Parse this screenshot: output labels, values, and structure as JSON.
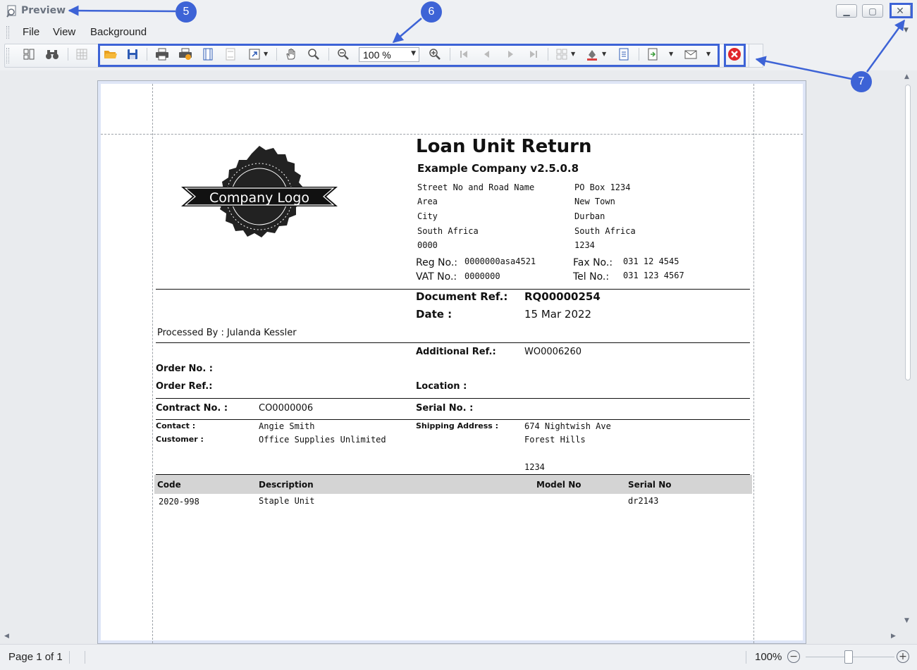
{
  "window": {
    "title": "Preview",
    "controls": {
      "minimize": "▁",
      "maximize": "▢",
      "close": "✕"
    }
  },
  "menu": {
    "items": [
      "File",
      "View",
      "Background"
    ]
  },
  "toolbar": {
    "zoom_value": "100 %",
    "icons": [
      "panes-icon",
      "find-icon",
      "thumbnails-icon",
      "open-icon",
      "save-icon",
      "print-icon",
      "quick-print-icon",
      "page-setup-icon",
      "header-footer-icon",
      "scale-icon",
      "hand-tool-icon",
      "magnifier-icon",
      "zoom-out-icon",
      "zoom-in-icon",
      "first-page-icon",
      "previous-page-icon",
      "next-page-icon",
      "last-page-icon",
      "multiple-pages-icon",
      "background-color-icon",
      "watermark-icon",
      "export-icon",
      "email-icon",
      "close-preview-icon"
    ]
  },
  "callouts": {
    "c5": "5",
    "c6": "6",
    "c7": "7"
  },
  "colors": {
    "annotation": "#3d63d6",
    "close_preview": "#e0262b",
    "table_header": "#d4d4d4"
  },
  "document": {
    "title": "Loan Unit Return",
    "company_name": "Example Company v2.5.0.8",
    "logo_text": "Company Logo",
    "address_left": [
      "Street No and Road Name",
      "Area",
      "City",
      "South Africa",
      "0000"
    ],
    "address_right": [
      "PO Box 1234",
      "New Town",
      "Durban",
      "South Africa",
      "1234"
    ],
    "reg_label": "Reg No.:",
    "reg_value": "0000000asa4521",
    "vat_label": "VAT No.:",
    "vat_value": "0000000",
    "fax_label": "Fax No.:",
    "fax_value": "031 12 4545",
    "tel_label": "Tel No.:",
    "tel_value": "031 123 4567",
    "docref_label": "Document Ref.:",
    "docref_value": "RQ00000254",
    "date_label": "Date :",
    "date_value": "15 Mar 2022",
    "processed_by": "Processed By : Julanda Kessler",
    "addref_label": "Additional Ref.:",
    "addref_value": "WO0006260",
    "order_no_label": "Order No. :",
    "order_ref_label": "Order Ref.:",
    "location_label": "Location :",
    "contract_label": "Contract No. :",
    "contract_value": "CO0000006",
    "serial_label": "Serial No. :",
    "contact_label": "Contact :",
    "contact_value": "Angie Smith",
    "customer_label": "Customer :",
    "customer_value": "Office Supplies Unlimited",
    "shipping_label": "Shipping Address :",
    "shipping_lines": [
      "674 Nightwish Ave",
      "Forest Hills",
      "",
      "1234"
    ],
    "table": {
      "headers": [
        "Code",
        "Description",
        "Model No",
        "Serial No"
      ],
      "rows": [
        {
          "code": "2020-998",
          "description": "Staple Unit",
          "model": "",
          "serial": "dr2143"
        }
      ]
    }
  },
  "status": {
    "page_info": "Page 1 of 1",
    "zoom": "100%",
    "zoom_out": "−",
    "zoom_in": "+"
  }
}
